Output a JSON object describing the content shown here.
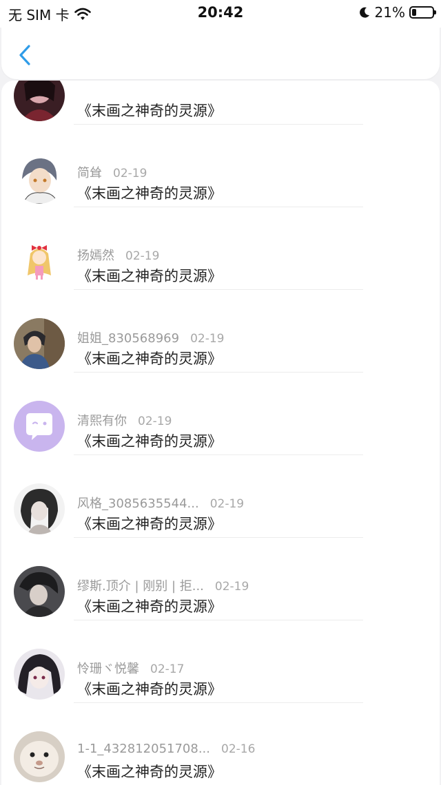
{
  "status_bar": {
    "carrier": "无 SIM 卡",
    "time": "20:42",
    "battery": "21%",
    "battery_level": 0.21
  },
  "nav": {
    "back_icon": "chevron-left-icon",
    "accent": "#2f9ce8"
  },
  "rows": [
    {
      "name": "",
      "date": "",
      "message": "《末画之神奇的灵源》"
    },
    {
      "name": "简耸",
      "date": "02-19",
      "message": "《末画之神奇的灵源》"
    },
    {
      "name": "扬嫣然",
      "date": "02-19",
      "message": "《末画之神奇的灵源》"
    },
    {
      "name": "姐姐_830568969",
      "date": "02-19",
      "message": "《末画之神奇的灵源》"
    },
    {
      "name": "清熙有你",
      "date": "02-19",
      "message": "《末画之神奇的灵源》"
    },
    {
      "name": "风格_3085635544...",
      "date": "02-19",
      "message": "《末画之神奇的灵源》"
    },
    {
      "name": "缪斯.顶介 | 刚别 | 拒...",
      "date": "02-19",
      "message": "《末画之神奇的灵源》"
    },
    {
      "name": "怜珊ヾ悦馨",
      "date": "02-17",
      "message": "《末画之神奇的灵源》"
    },
    {
      "name": "1-1_432812051708...",
      "date": "02-16",
      "message": "《末画之神奇的灵源》"
    }
  ]
}
